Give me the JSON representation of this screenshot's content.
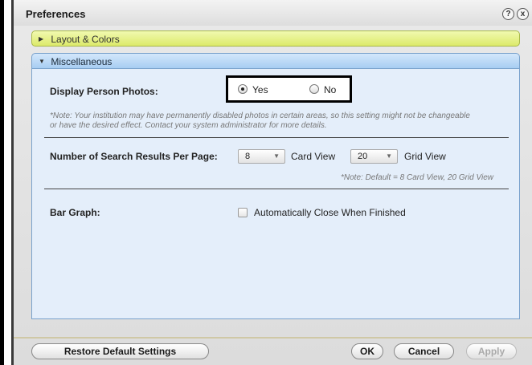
{
  "window": {
    "title": "Preferences"
  },
  "titlebar": {
    "help_glyph": "?",
    "close_glyph": "x"
  },
  "sections": {
    "layout": {
      "label": "Layout & Colors",
      "expanded": false
    },
    "misc": {
      "label": "Miscellaneous",
      "expanded": true
    }
  },
  "misc": {
    "photos_label": "Display Person Photos:",
    "photos_yes": "Yes",
    "photos_no": "No",
    "photos_selected": "Yes",
    "photos_note_line1": "*Note: Your institution may have permanently disabled photos in certain areas, so this setting might not be changeable",
    "photos_note_line2": "or have the desired effect. Contact your system administrator for more details.",
    "results_label": "Number of Search Results Per Page:",
    "card_value": "8",
    "card_label": "Card View",
    "grid_value": "20",
    "grid_label": "Grid View",
    "results_note": "*Note: Default = 8 Card View, 20 Grid View",
    "bargraph_label": "Bar Graph:",
    "autoclose_label": "Automatically Close When Finished",
    "autoclose_checked": false
  },
  "footer": {
    "restore_label": "Restore Default Settings",
    "ok_label": "OK",
    "cancel_label": "Cancel",
    "apply_label": "Apply",
    "apply_enabled": false
  },
  "icons": {
    "layout_arrow": "triangle-right-icon",
    "misc_arrow": "triangle-down-icon",
    "help": "help-icon",
    "close": "close-icon"
  }
}
